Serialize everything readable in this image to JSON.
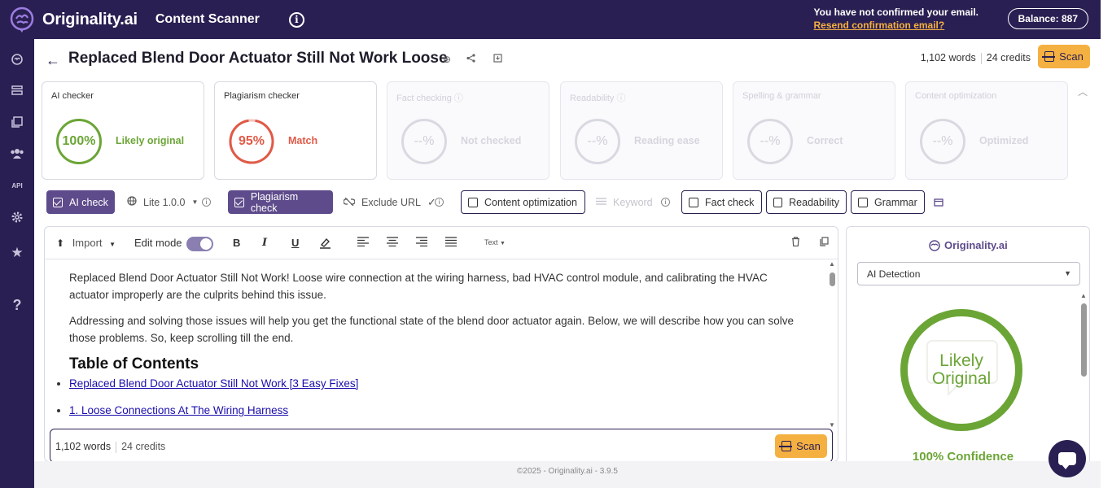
{
  "topbar": {
    "logo_text": "Originality.ai",
    "app_title": "Content Scanner",
    "email_notice": "You have not confirmed your email.",
    "resend_link": "Resend confirmation email?",
    "balance": "Balance: 887"
  },
  "document": {
    "title": "Replaced Blend Door Actuator Still Not Work Loose",
    "words": "1,102 words",
    "credits": "24 credits",
    "scan_label": "Scan"
  },
  "checkers": [
    {
      "title": "AI checker",
      "value": "100%",
      "label": "Likely original",
      "color": "#6ba536",
      "active": true
    },
    {
      "title": "Plagiarism checker",
      "value": "95%",
      "label": "Match",
      "color": "#e05a47",
      "active": true
    },
    {
      "title": "Fact checking",
      "value": "--%",
      "label": "Not checked",
      "active": false
    },
    {
      "title": "Readability",
      "value": "--%",
      "label": "Reading ease",
      "active": false
    },
    {
      "title": "Spelling & grammar",
      "value": "--%",
      "label": "Correct",
      "active": false
    },
    {
      "title": "Content optimization",
      "value": "--%",
      "label": "Optimized",
      "active": false
    }
  ],
  "options": {
    "ai_check": "AI check",
    "model": "Lite 1.0.0",
    "plagiarism_check": "Plagiarism check",
    "exclude_url": "Exclude URL",
    "content_optimization": "Content optimization",
    "keyword": "Keyword",
    "fact_check": "Fact check",
    "readability": "Readability",
    "grammar": "Grammar"
  },
  "editor": {
    "import_label": "Import",
    "edit_mode_label": "Edit mode",
    "text_style": "Text",
    "paragraphs": [
      "Replaced Blend Door Actuator Still Not Work! Loose wire connection at the wiring harness, bad HVAC control module, and calibrating the HVAC actuator improperly are the culprits behind this issue.",
      "Addressing and solving those issues will help you get the functional state of the blend door actuator again. Below, we will describe how you can solve those problems. So, keep scrolling till the end."
    ],
    "heading": "Table of Contents",
    "links": [
      "Replaced Blend Door Actuator Still Not Work [3 Easy Fixes]",
      "1. Loose Connections At The Wiring Harness "
    ],
    "footer_words": "1,102 words",
    "footer_credits": "24 credits",
    "footer_scan": "Scan"
  },
  "panel": {
    "brand": "Originality.ai",
    "select_value": "AI Detection",
    "ring_text_1": "Likely",
    "ring_text_2": "Original",
    "confidence": "100% Confidence"
  },
  "footer": {
    "text": "©2025 - Originality.ai - 3.9.5"
  },
  "colors": {
    "brand_dark": "#2a1f52",
    "accent": "#f5b042",
    "success": "#6ba536",
    "danger": "#e05a47"
  }
}
